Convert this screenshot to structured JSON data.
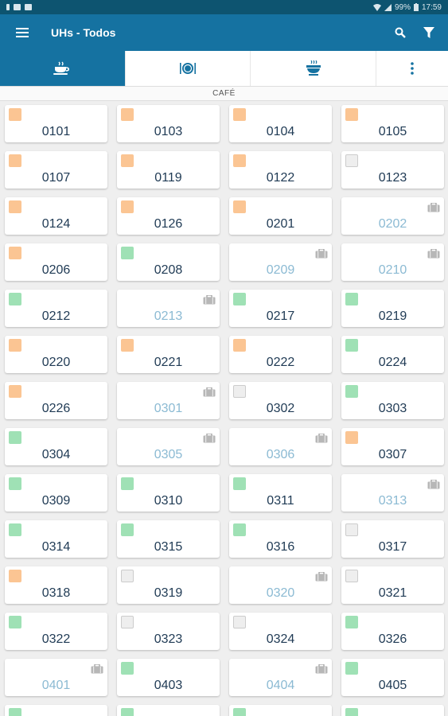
{
  "statusbar": {
    "battery": "99%",
    "time": "17:59"
  },
  "toolbar": {
    "title": "UHs - Todos"
  },
  "section_label": "CAFÉ",
  "rooms": [
    {
      "n": "0101",
      "s": "orange"
    },
    {
      "n": "0103",
      "s": "orange"
    },
    {
      "n": "0104",
      "s": "orange"
    },
    {
      "n": "0105",
      "s": "orange"
    },
    {
      "n": "0107",
      "s": "orange"
    },
    {
      "n": "0119",
      "s": "orange"
    },
    {
      "n": "0122",
      "s": "orange"
    },
    {
      "n": "0123",
      "s": "gray"
    },
    {
      "n": "0124",
      "s": "orange"
    },
    {
      "n": "0126",
      "s": "orange"
    },
    {
      "n": "0201",
      "s": "orange"
    },
    {
      "n": "0202",
      "s": "case"
    },
    {
      "n": "0206",
      "s": "orange"
    },
    {
      "n": "0208",
      "s": "green"
    },
    {
      "n": "0209",
      "s": "case"
    },
    {
      "n": "0210",
      "s": "case"
    },
    {
      "n": "0212",
      "s": "green"
    },
    {
      "n": "0213",
      "s": "case"
    },
    {
      "n": "0217",
      "s": "green"
    },
    {
      "n": "0219",
      "s": "green"
    },
    {
      "n": "0220",
      "s": "orange"
    },
    {
      "n": "0221",
      "s": "orange"
    },
    {
      "n": "0222",
      "s": "orange"
    },
    {
      "n": "0224",
      "s": "green"
    },
    {
      "n": "0226",
      "s": "orange"
    },
    {
      "n": "0301",
      "s": "case"
    },
    {
      "n": "0302",
      "s": "gray"
    },
    {
      "n": "0303",
      "s": "green"
    },
    {
      "n": "0304",
      "s": "green"
    },
    {
      "n": "0305",
      "s": "case"
    },
    {
      "n": "0306",
      "s": "case"
    },
    {
      "n": "0307",
      "s": "orange"
    },
    {
      "n": "0309",
      "s": "green"
    },
    {
      "n": "0310",
      "s": "green"
    },
    {
      "n": "0311",
      "s": "green"
    },
    {
      "n": "0313",
      "s": "case"
    },
    {
      "n": "0314",
      "s": "green"
    },
    {
      "n": "0315",
      "s": "green"
    },
    {
      "n": "0316",
      "s": "green"
    },
    {
      "n": "0317",
      "s": "gray"
    },
    {
      "n": "0318",
      "s": "orange"
    },
    {
      "n": "0319",
      "s": "gray"
    },
    {
      "n": "0320",
      "s": "case"
    },
    {
      "n": "0321",
      "s": "gray"
    },
    {
      "n": "0322",
      "s": "green"
    },
    {
      "n": "0323",
      "s": "gray"
    },
    {
      "n": "0324",
      "s": "gray"
    },
    {
      "n": "0326",
      "s": "green"
    },
    {
      "n": "0401",
      "s": "case"
    },
    {
      "n": "0403",
      "s": "green"
    },
    {
      "n": "0404",
      "s": "case"
    },
    {
      "n": "0405",
      "s": "green"
    },
    {
      "n": "",
      "s": "green"
    },
    {
      "n": "",
      "s": "green"
    },
    {
      "n": "",
      "s": "green"
    },
    {
      "n": "",
      "s": "green"
    }
  ],
  "colors": {
    "accent": "#1572a1",
    "orange": "#fbc593",
    "green": "#9fe1b5",
    "gray": "#eeeeee",
    "dim_text": "#8bbad3"
  }
}
